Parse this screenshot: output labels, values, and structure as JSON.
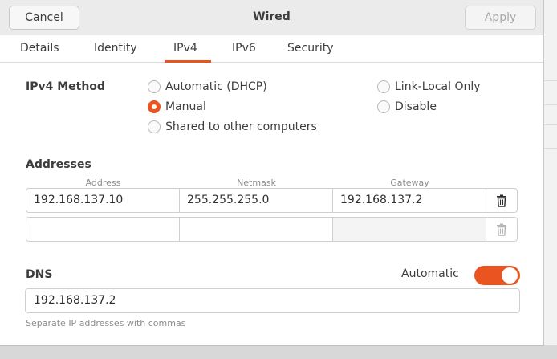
{
  "header": {
    "cancel_label": "Cancel",
    "title": "Wired",
    "apply_label": "Apply"
  },
  "tabs": [
    {
      "label": "Details",
      "active": false
    },
    {
      "label": "Identity",
      "active": false
    },
    {
      "label": "IPv4",
      "active": true
    },
    {
      "label": "IPv6",
      "active": false
    },
    {
      "label": "Security",
      "active": false
    }
  ],
  "ipv4_method": {
    "label": "IPv4 Method",
    "options": [
      {
        "label": "Automatic (DHCP)",
        "selected": false
      },
      {
        "label": "Manual",
        "selected": true
      },
      {
        "label": "Shared to other computers",
        "selected": false
      },
      {
        "label": "Link-Local Only",
        "selected": false
      },
      {
        "label": "Disable",
        "selected": false
      }
    ]
  },
  "addresses": {
    "label": "Addresses",
    "columns": [
      "Address",
      "Netmask",
      "Gateway"
    ],
    "rows": [
      {
        "address": "192.168.137.10",
        "netmask": "255.255.255.0",
        "gateway": "192.168.137.2"
      },
      {
        "address": "",
        "netmask": "",
        "gateway": ""
      }
    ]
  },
  "dns": {
    "label": "DNS",
    "automatic_label": "Automatic",
    "automatic_on": true,
    "value": "192.168.137.2",
    "hint": "Separate IP addresses with commas"
  },
  "colors": {
    "accent": "#e95420",
    "header_bg": "#ebebeb"
  }
}
